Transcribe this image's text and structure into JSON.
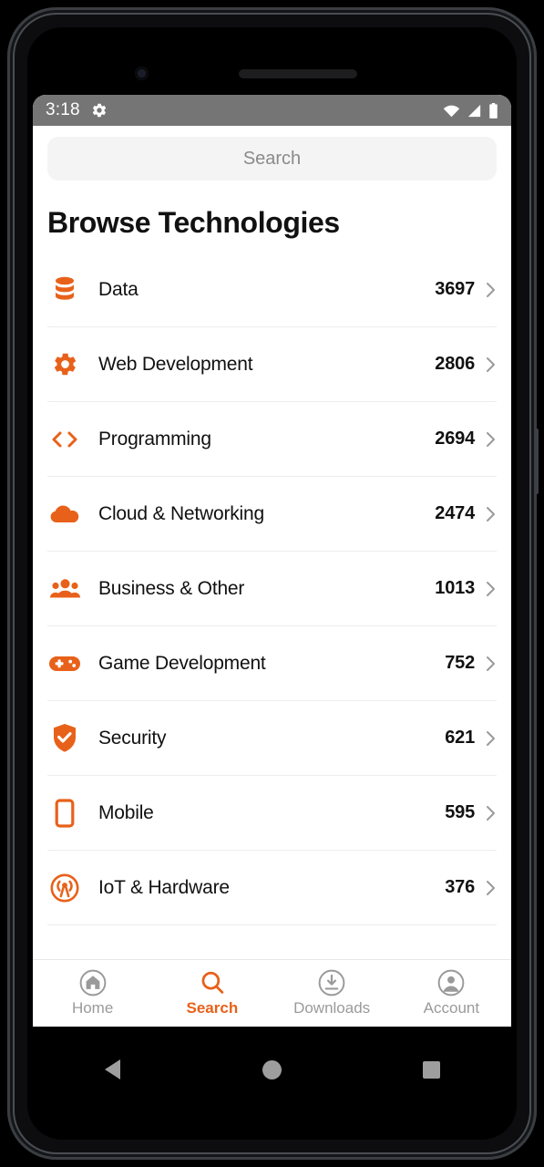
{
  "theme": {
    "accent": "#e8611a",
    "text_primary": "#111111",
    "text_muted": "#9a9a9a",
    "status_bar_bg": "#757575",
    "search_field_bg": "#f4f4f4",
    "divider": "#ededed"
  },
  "status_bar": {
    "time": "3:18",
    "icons": [
      "gear-icon",
      "wifi-icon",
      "cellular-signal-icon",
      "battery-icon"
    ]
  },
  "search": {
    "placeholder": "Search",
    "value": ""
  },
  "header": {
    "title": "Browse Technologies"
  },
  "categories": [
    {
      "label": "Data",
      "count": "3697",
      "icon": "database-icon"
    },
    {
      "label": "Web Development",
      "count": "2806",
      "icon": "gear-icon"
    },
    {
      "label": "Programming",
      "count": "2694",
      "icon": "code-brackets-icon"
    },
    {
      "label": "Cloud & Networking",
      "count": "2474",
      "icon": "cloud-icon"
    },
    {
      "label": "Business & Other",
      "count": "1013",
      "icon": "people-group-icon"
    },
    {
      "label": "Game Development",
      "count": "752",
      "icon": "gamepad-icon"
    },
    {
      "label": "Security",
      "count": "621",
      "icon": "shield-check-icon"
    },
    {
      "label": "Mobile",
      "count": "595",
      "icon": "smartphone-icon"
    },
    {
      "label": "IoT & Hardware",
      "count": "376",
      "icon": "broadcast-sensor-icon"
    }
  ],
  "bottom_nav": {
    "items": [
      {
        "label": "Home",
        "icon": "home-circle-icon",
        "active": false
      },
      {
        "label": "Search",
        "icon": "magnifier-icon",
        "active": true
      },
      {
        "label": "Downloads",
        "icon": "download-circle-icon",
        "active": false
      },
      {
        "label": "Account",
        "icon": "account-circle-icon",
        "active": false
      }
    ]
  },
  "system_nav": {
    "buttons": [
      "back-triangle-icon",
      "home-circle-icon",
      "recents-square-icon"
    ]
  }
}
